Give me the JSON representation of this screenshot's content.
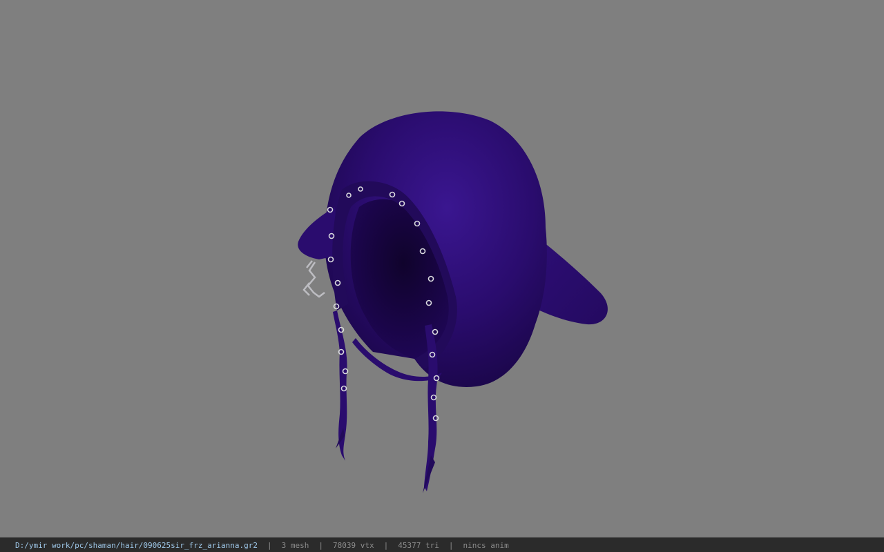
{
  "viewport": {
    "background": "#7f7f7f",
    "model": {
      "name": "hooded-cloak-with-braids",
      "main_color": "#2a0c6e",
      "ring_color": "#d9d9de",
      "chain_color": "#bdbdc2"
    }
  },
  "statusbar": {
    "path": "D:/ymir work/pc/shaman/hair/090625sir_frz_arianna.gr2",
    "mesh": "3 mesh",
    "vtx": "78039 vtx",
    "tri": "45377 tri",
    "anim": "nincs anim",
    "separator": "|",
    "path_color": "#9ec7e8"
  }
}
